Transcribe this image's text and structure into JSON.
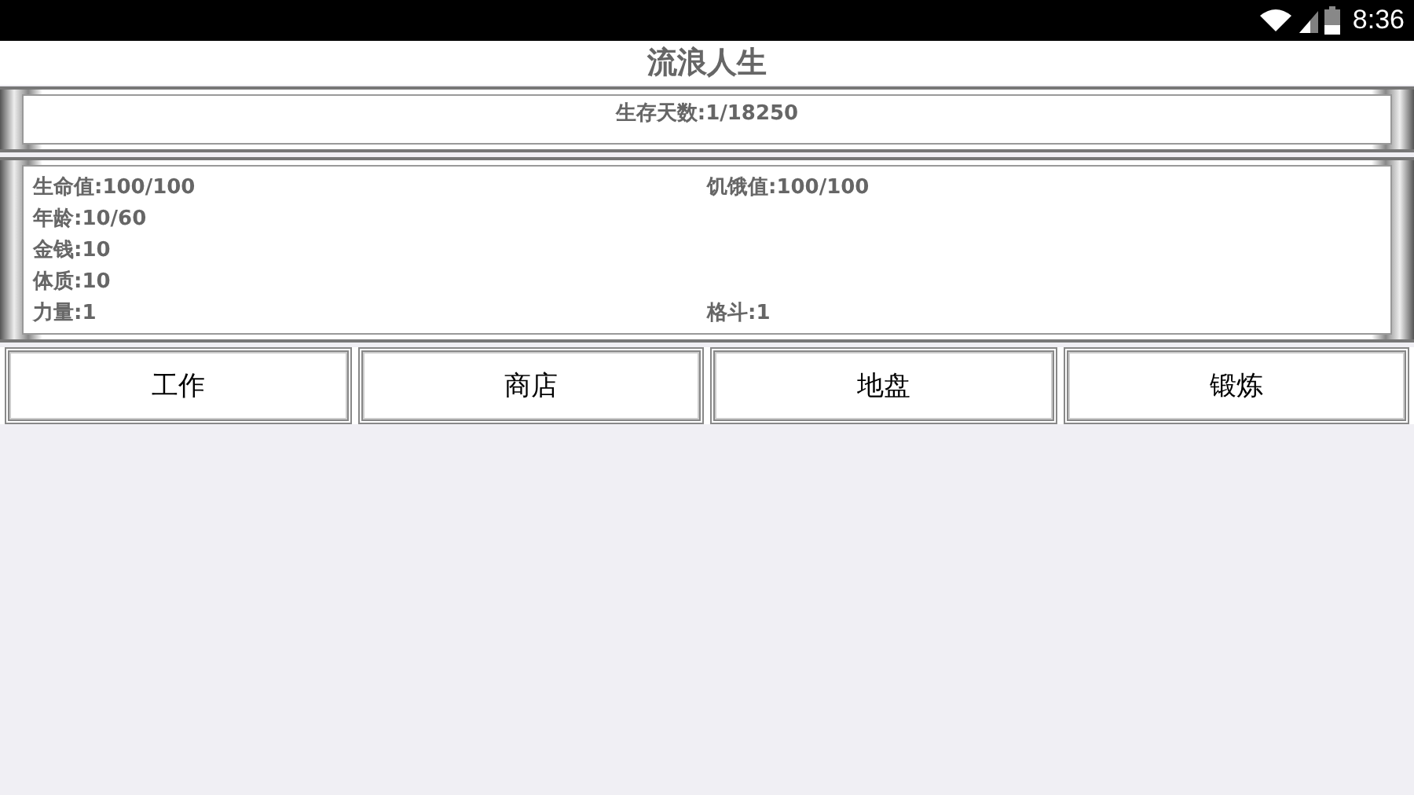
{
  "status_bar": {
    "time": "8:36"
  },
  "title": "流浪人生",
  "days": "生存天数:1/18250",
  "stats": [
    {
      "left": "生命值:100/100",
      "right": "饥饿值:100/100"
    },
    {
      "left": "年龄:10/60"
    },
    {
      "left": "金钱:10"
    },
    {
      "left": "体质:10"
    },
    {
      "left": "力量:1",
      "right": "格斗:1"
    }
  ],
  "buttons": [
    "工作",
    "商店",
    "地盘",
    "锻炼"
  ]
}
